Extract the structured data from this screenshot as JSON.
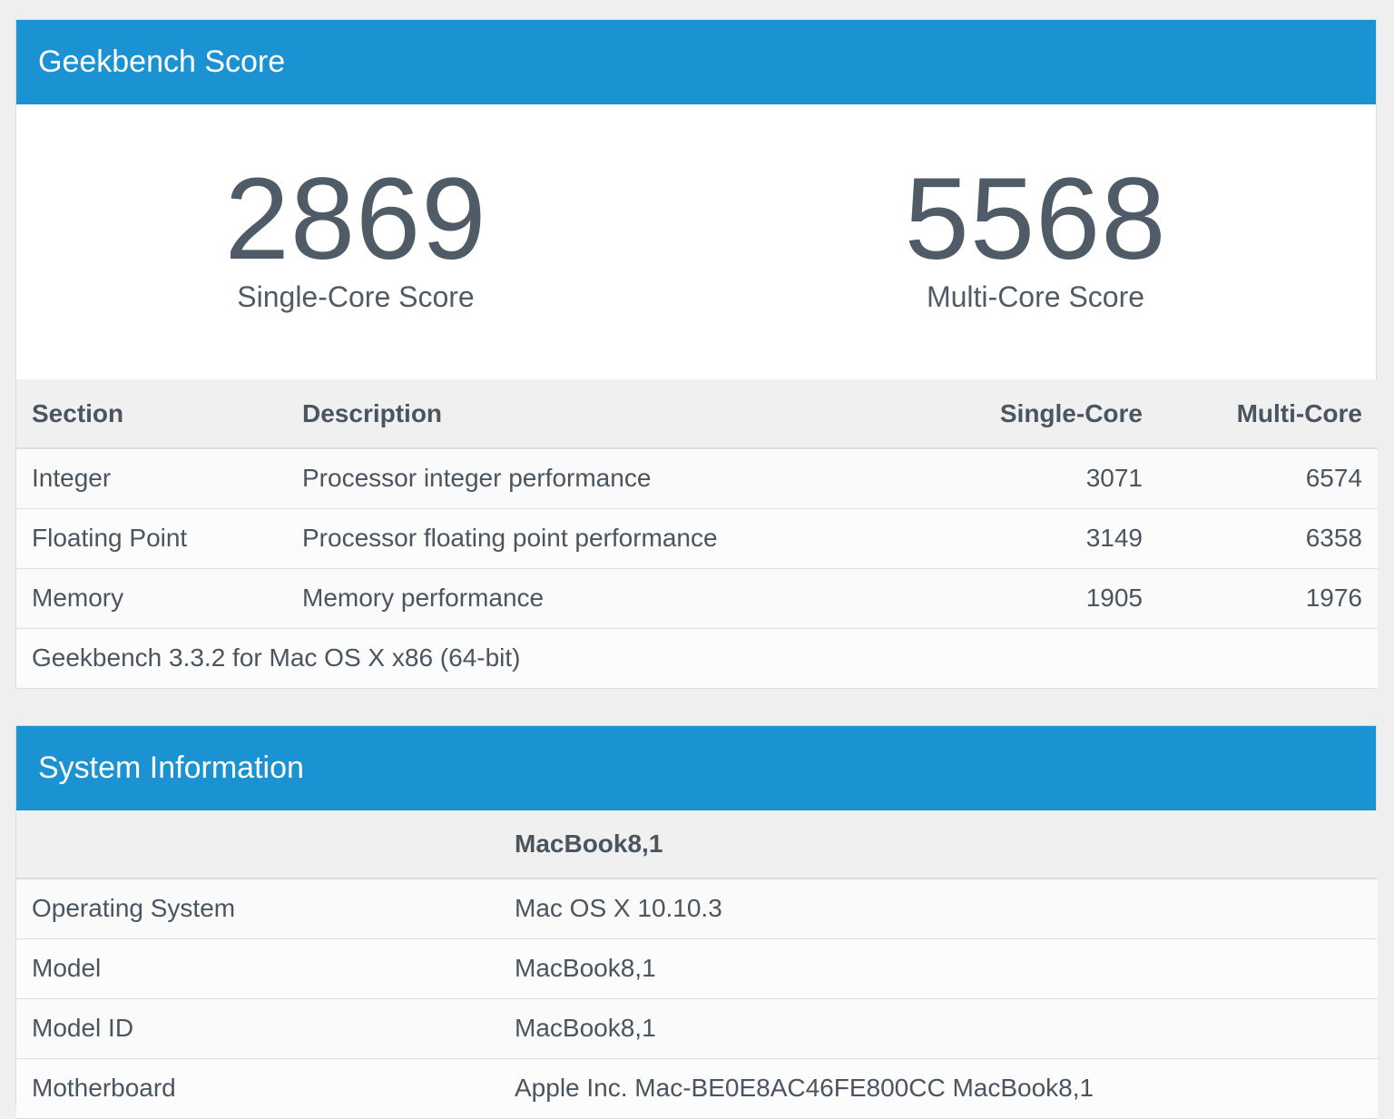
{
  "score_panel": {
    "title": "Geekbench Score",
    "single_core": {
      "value": "2869",
      "label": "Single-Core Score"
    },
    "multi_core": {
      "value": "5568",
      "label": "Multi-Core Score"
    },
    "table": {
      "headers": [
        "Section",
        "Description",
        "Single-Core",
        "Multi-Core"
      ],
      "rows": [
        [
          "Integer",
          "Processor integer performance",
          "3071",
          "6574"
        ],
        [
          "Floating Point",
          "Processor floating point performance",
          "3149",
          "6358"
        ],
        [
          "Memory",
          "Memory performance",
          "1905",
          "1976"
        ]
      ],
      "footer": "Geekbench 3.3.2 for Mac OS X x86 (64-bit)"
    }
  },
  "system_panel": {
    "title": "System Information",
    "header_value": "MacBook8,1",
    "rows": [
      [
        "Operating System",
        "Mac OS X 10.10.3"
      ],
      [
        "Model",
        "MacBook8,1"
      ],
      [
        "Model ID",
        "MacBook8,1"
      ],
      [
        "Motherboard",
        "Apple Inc. Mac-BE0E8AC46FE800CC MacBook8,1"
      ]
    ]
  }
}
